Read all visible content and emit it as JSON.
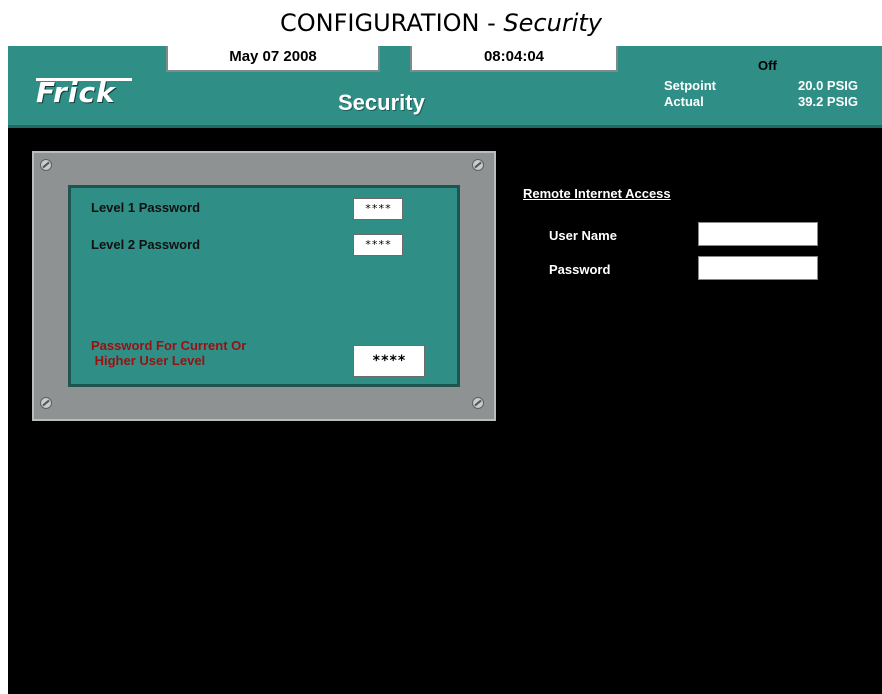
{
  "document": {
    "title_main": "CONFIGURATION - ",
    "title_sub": "Security"
  },
  "header": {
    "logo": "Frick",
    "date": "May 07 2008",
    "time": "08:04:04",
    "page_title": "Security",
    "status": "Off",
    "setpoint_label": "Setpoint",
    "setpoint_value": "20.0 PSIG",
    "actual_label": "Actual",
    "actual_value": "39.2 PSIG"
  },
  "passwords": {
    "level1_label": "Level 1 Password",
    "level1_value": "****",
    "level2_label": "Level 2 Password",
    "level2_value": "****",
    "current_label_line1": "Password For Current Or",
    "current_label_line2": " Higher User Level",
    "current_value": "****"
  },
  "remote": {
    "title": "Remote Internet Access",
    "username_label": "User Name",
    "username_value": "",
    "password_label": "Password",
    "password_value": ""
  },
  "colors": {
    "panel_teal": "#2f8f86",
    "plate_gray": "#8f9292",
    "warning_red": "#9a1010",
    "background": "#000000"
  },
  "icons": [
    "screw-icon"
  ]
}
